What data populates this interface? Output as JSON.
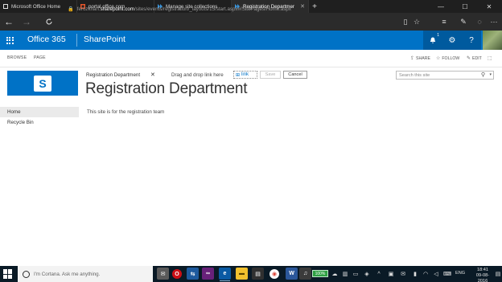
{
  "browser": {
    "tabs": [
      {
        "title": "Microsoft Office Home",
        "active": false
      },
      {
        "title": "portal.office.com",
        "active": false
      },
      {
        "title": "Manage site collections",
        "active": false
      },
      {
        "title": "Registration Departmer",
        "active": true
      }
    ],
    "new_tab_glyph": "+",
    "window_controls": {
      "minimize": "—",
      "maximize": "☐",
      "close": "✕"
    },
    "address": {
      "prefix": "ferozkhan.",
      "host": "sharepoint.com",
      "path": "/sites/events/registration/_layouts/15/start.aspx#/SitePages/Home.aspx"
    }
  },
  "suitebar": {
    "app_launcher_icon": "waffle-icon",
    "brand": "Office 365",
    "product": "SharePoint",
    "notification_count": "1",
    "accent": "#0072c6"
  },
  "ribbon": {
    "tabs": [
      "BROWSE",
      "PAGE"
    ],
    "actions": {
      "share": "SHARE",
      "follow": "FOLLOW",
      "edit": "EDIT"
    }
  },
  "site": {
    "logo_letter": "S",
    "breadcrumb": "Registration Department",
    "drag_drop_text": "Drag and drop link here",
    "link_label": "link",
    "save_label": "Save",
    "cancel_label": "Cancel",
    "title": "Registration Department",
    "search_placeholder": "Search this site",
    "description": "This site is for the registration team"
  },
  "leftnav": {
    "items": [
      {
        "label": "Home",
        "selected": true
      },
      {
        "label": "Recycle Bin",
        "selected": false
      }
    ]
  },
  "taskbar": {
    "cortana_placeholder": "I'm Cortana. Ask me anything.",
    "battery": "100%",
    "language": "ENG",
    "time": "18:41",
    "date": "09-08-2016"
  }
}
